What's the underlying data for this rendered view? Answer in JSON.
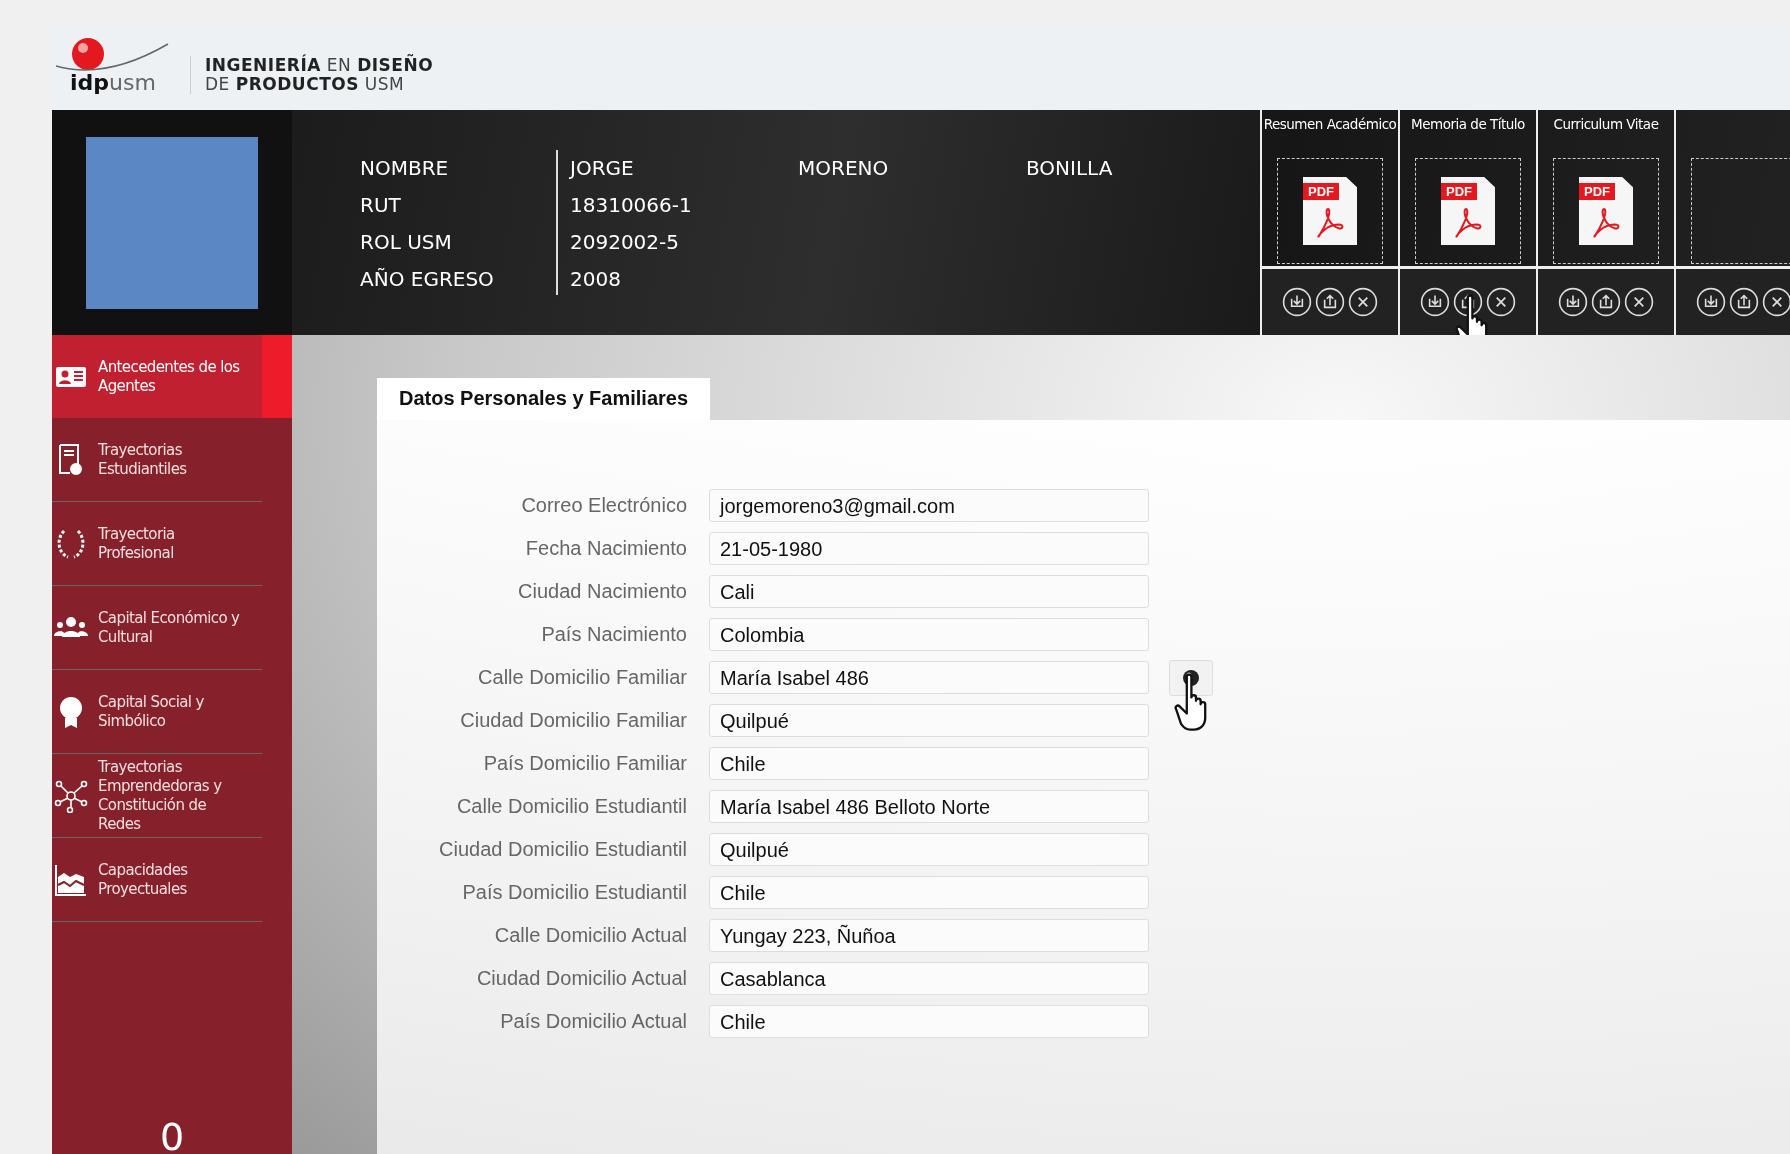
{
  "brand": {
    "logo_word_bold": "idp",
    "logo_word": "usm",
    "title_line_1": "**INGENIERÍA** EN **DISEÑO**",
    "title_line_2": "DE **PRODUCTOS** USM"
  },
  "profile": {
    "rows": [
      {
        "label": "NOMBRE",
        "values": [
          "JORGE",
          "MORENO",
          "BONILLA"
        ]
      },
      {
        "label": "RUT",
        "values": [
          "18310066-1"
        ]
      },
      {
        "label": "ROL USM",
        "values": [
          "2092002-5"
        ]
      },
      {
        "label": "AÑO EGRESO",
        "values": [
          "2008"
        ]
      }
    ]
  },
  "documents": [
    {
      "title": "Resumen Académico",
      "kind": "pdf",
      "file_label": "PDF",
      "cursor": false
    },
    {
      "title": "Memoria de Título",
      "kind": "pdf",
      "file_label": "PDF",
      "cursor": true
    },
    {
      "title": "Curriculum Vitae",
      "kind": "pdf",
      "file_label": "PDF",
      "cursor": false
    },
    {
      "kind": "empty",
      "cursor": false
    }
  ],
  "sidebar": {
    "items": [
      {
        "label": "Antecedentes de los Agentes",
        "selected": true
      },
      {
        "label": "Trayectorias Estudiantiles",
        "selected": false
      },
      {
        "label": "Trayectoria Profesional",
        "selected": false
      },
      {
        "label": "Capital Económico y Cultural",
        "selected": false
      },
      {
        "label": "Capital Social y Simbólico",
        "selected": false
      },
      {
        "label": "Trayectorias Emprendedoras y Constitución de Redes",
        "selected": false
      },
      {
        "label": "Capacidades Proyectuales",
        "selected": false
      }
    ],
    "footer_count": "0"
  },
  "panel": {
    "tab": "Datos Personales y Familiares",
    "fields": [
      {
        "label": "Correo Electrónico",
        "value": "jorgemoreno3@gmail.com",
        "map_button": false
      },
      {
        "label": "Fecha Nacimiento",
        "value": "21-05-1980",
        "map_button": false
      },
      {
        "label": "Ciudad Nacimiento",
        "value": "Cali",
        "map_button": false
      },
      {
        "label": "País Nacimiento",
        "value": "Colombia",
        "map_button": false
      },
      {
        "label": "Calle Domicilio Familiar",
        "value": "María Isabel 486",
        "map_button": true
      },
      {
        "label": "Ciudad Domicilio Familiar",
        "value": "Quilpué",
        "map_button": false
      },
      {
        "label": "País Domicilio Familiar",
        "value": "Chile",
        "map_button": false
      },
      {
        "label": "Calle Domicilio Estudiantil",
        "value": "María Isabel 486 Belloto Norte",
        "map_button": false
      },
      {
        "label": "Ciudad Domicilio Estudiantil",
        "value": "Quilpué",
        "map_button": false
      },
      {
        "label": "País Domicilio Estudiantil",
        "value": "Chile",
        "map_button": false
      },
      {
        "label": "Calle Domicilio Actual",
        "value": "Yungay 223, Ñuñoa",
        "map_button": false
      },
      {
        "label": "Ciudad Domicilio Actual",
        "value": "Casablanca",
        "map_button": false
      },
      {
        "label": "País Domicilio Actual",
        "value": "Chile",
        "map_button": false
      }
    ]
  }
}
